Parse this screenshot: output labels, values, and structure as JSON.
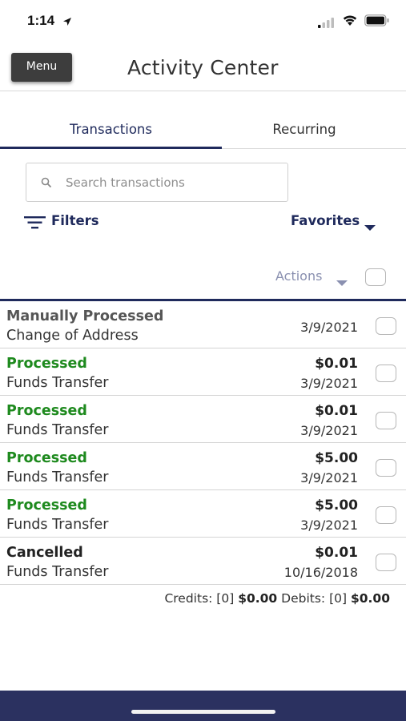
{
  "status_bar": {
    "time": "1:14"
  },
  "header": {
    "menu_label": "Menu",
    "title": "Activity Center"
  },
  "tabs": [
    {
      "label": "Transactions",
      "active": true
    },
    {
      "label": "Recurring",
      "active": false
    }
  ],
  "search": {
    "placeholder": "Search transactions"
  },
  "toolbar": {
    "filters_label": "Filters",
    "favorites_label": "Favorites",
    "actions_label": "Actions"
  },
  "transactions": [
    {
      "status": "Manually Processed",
      "status_color": "#555555",
      "type": "Change of Address",
      "amount": "",
      "date": "3/9/2021"
    },
    {
      "status": "Processed",
      "status_color": "#1e8a1e",
      "type": "Funds Transfer",
      "amount": "$0.01",
      "date": "3/9/2021"
    },
    {
      "status": "Processed",
      "status_color": "#1e8a1e",
      "type": "Funds Transfer",
      "amount": "$0.01",
      "date": "3/9/2021"
    },
    {
      "status": "Processed",
      "status_color": "#1e8a1e",
      "type": "Funds Transfer",
      "amount": "$5.00",
      "date": "3/9/2021"
    },
    {
      "status": "Processed",
      "status_color": "#1e8a1e",
      "type": "Funds Transfer",
      "amount": "$5.00",
      "date": "3/9/2021"
    },
    {
      "status": "Cancelled",
      "status_color": "#222222",
      "type": "Funds Transfer",
      "amount": "$0.01",
      "date": "10/16/2018"
    }
  ],
  "totals": {
    "credits_label": "Credits: [0]",
    "credits_amount": "$0.00",
    "debits_label": "Debits: [0]",
    "debits_amount": "$0.00"
  },
  "colors": {
    "accent": "#1f2a5c",
    "processed": "#1e8a1e",
    "bottom_bar": "#2b3160"
  }
}
